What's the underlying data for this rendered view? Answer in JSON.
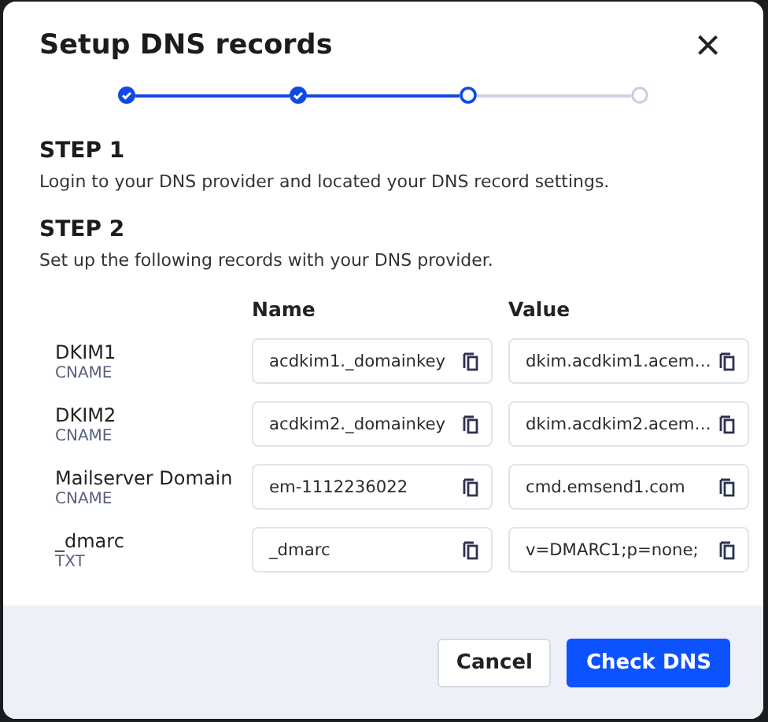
{
  "dialog": {
    "title": "Setup DNS records",
    "close": "×"
  },
  "stepper": [
    {
      "kind": "done"
    },
    {
      "kind": "done"
    },
    {
      "kind": "current"
    },
    {
      "kind": "upcoming"
    }
  ],
  "steps": [
    {
      "heading": "STEP 1",
      "text": "Login to your DNS provider and located your DNS record settings."
    },
    {
      "heading": "STEP 2",
      "text": "Set up the following records with your DNS provider."
    }
  ],
  "table": {
    "columns": [
      "Name",
      "Value"
    ],
    "rows": [
      {
        "label": "DKIM1",
        "type": "CNAME",
        "name": "acdkim1._domainkey",
        "value": "dkim.acdkim1.acem…"
      },
      {
        "label": "DKIM2",
        "type": "CNAME",
        "name": "acdkim2._domainkey",
        "value": "dkim.acdkim2.acem…"
      },
      {
        "label": "Mailserver Domain",
        "type": "CNAME",
        "name": "em-1112236022",
        "value": "cmd.emsend1.com"
      },
      {
        "label": "_dmarc",
        "type": "TXT",
        "name": "_dmarc",
        "value": "v=DMARC1;p=none;"
      }
    ]
  },
  "buttons": [
    {
      "label": "Cancel",
      "kind": "secondary"
    },
    {
      "label": "Check DNS",
      "kind": "primary"
    }
  ]
}
